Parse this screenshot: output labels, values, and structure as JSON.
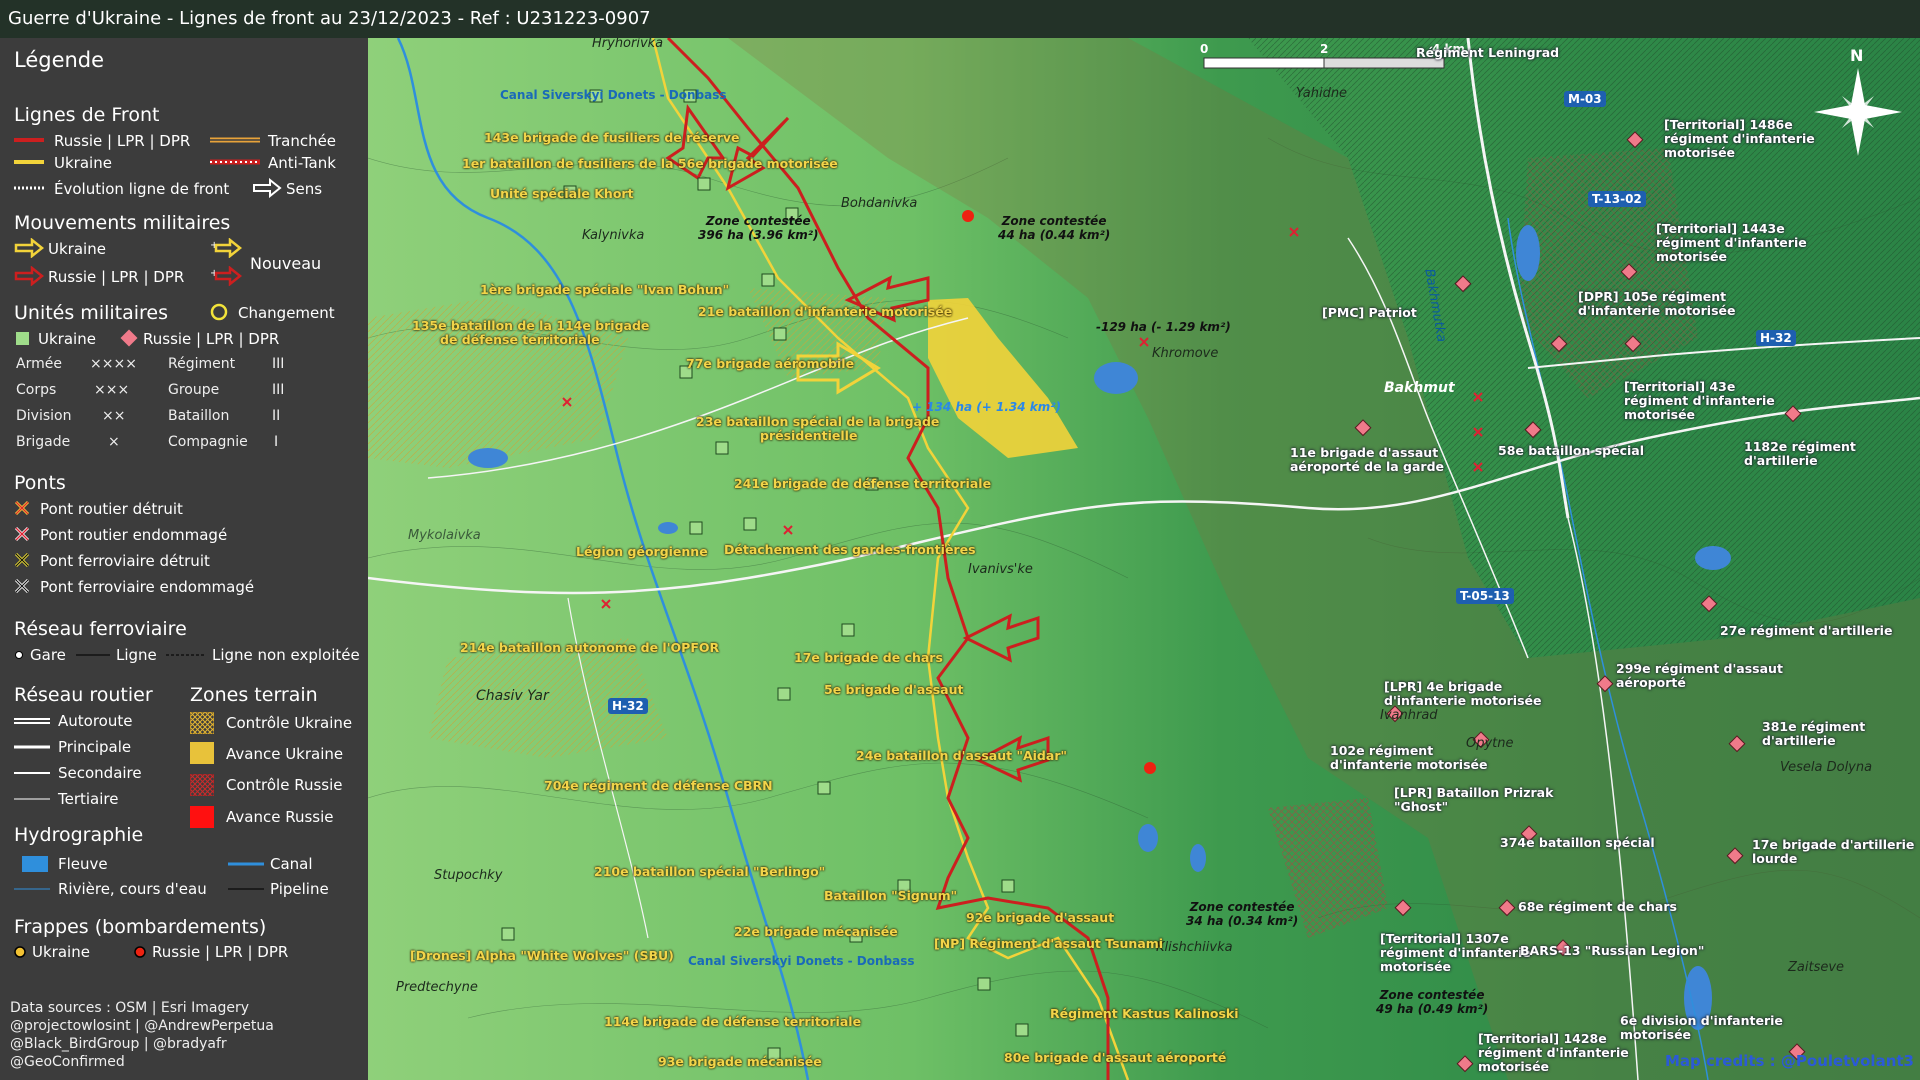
{
  "title": "Guerre d'Ukraine - Lignes de front au 23/12/2023 - Ref : U231223-0907",
  "legend": {
    "heading": "Légende",
    "front_lines": {
      "title": "Lignes de Front",
      "russia": "Russie | LPR | DPR",
      "ukraine": "Ukraine",
      "trench": "Tranchée",
      "antitank": "Anti-Tank",
      "evolution": "Évolution ligne de front",
      "direction": "Sens"
    },
    "movements": {
      "title": "Mouvements militaires",
      "ukraine": "Ukraine",
      "russia": "Russie | LPR | DPR",
      "new": "Nouveau"
    },
    "units": {
      "title": "Unités militaires",
      "change": "Changement",
      "ukraine": "Ukraine",
      "russia": "Russie | LPR | DPR",
      "rows": [
        {
          "a": "Armée",
          "as": "××××",
          "b": "Régiment",
          "bs": "III"
        },
        {
          "a": "Corps",
          "as": "×××",
          "b": "Groupe",
          "bs": "III"
        },
        {
          "a": "Division",
          "as": "××",
          "b": "Bataillon",
          "bs": "II"
        },
        {
          "a": "Brigade",
          "as": "×",
          "b": "Compagnie",
          "bs": "I"
        }
      ]
    },
    "bridges": {
      "title": "Ponts",
      "items": [
        "Pont routier détruit",
        "Pont routier endommagé",
        "Pont ferroviaire détruit",
        "Pont ferroviaire endommagé"
      ]
    },
    "rail": {
      "title": "Réseau ferroviaire",
      "station": "Gare",
      "line": "Ligne",
      "unused": "Ligne non exploitée"
    },
    "roads": {
      "title": "Réseau routier",
      "items": [
        "Autoroute",
        "Principale",
        "Secondaire",
        "Tertiaire"
      ]
    },
    "terrain": {
      "title": "Zones terrain",
      "items": [
        "Contrôle Ukraine",
        "Avance Ukraine",
        "Contrôle Russie",
        "Avance Russie"
      ]
    },
    "hydro": {
      "title": "Hydrographie",
      "river": "Fleuve",
      "canal": "Canal",
      "stream": "Rivière, cours d'eau",
      "pipeline": "Pipeline"
    },
    "strikes": {
      "title": "Frappes (bombardements)",
      "ukraine": "Ukraine",
      "russia": "Russie | LPR | DPR"
    },
    "sources": [
      "Data sources : OSM | Esri Imagery",
      "@projectowlosint | @AndrewPerpetua",
      "@Black_BirdGroup | @bradyafr",
      "@GeoConfirmed"
    ]
  },
  "colors": {
    "russia": "#cc1f1f",
    "ukraine": "#f2d33a",
    "trench": "#e8a33a",
    "water": "#3a78c8",
    "road_badge": "#1e5fb0",
    "panel": "#3c3c3c"
  },
  "map": {
    "scale": [
      "0",
      "2",
      "4 km"
    ],
    "north": "N",
    "towns": [
      "Bohdanivka",
      "Kalynivka",
      "Chasiv Yar",
      "Ivanivs'ke",
      "Khromove",
      "Bakhmut",
      "Yahidne",
      "Opytne",
      "Ivanhrad",
      "Vesela Dolyna",
      "Zaitseve",
      "Klishchiivka",
      "Predtechyne",
      "Stupochky",
      "Hryhorivka",
      "Mykolaivka",
      "Bakhmutka"
    ],
    "canal": "Canal Siverskyi Donets - Donbass",
    "roads": [
      "M-03",
      "T-13-02",
      "H-32",
      "T-05-13",
      "H-32"
    ],
    "zones": [
      {
        "t1": "Zone contestée",
        "t2": "396 ha (3.96 km²)"
      },
      {
        "t1": "Zone contestée",
        "t2": "44 ha (0.44 km²)"
      },
      {
        "t1": "-129 ha (- 1.29 km²)",
        "t2": ""
      },
      {
        "t1": "+ 134 ha (+ 1.34 km²)",
        "t2": ""
      },
      {
        "t1": "Zone contestée",
        "t2": "34 ha (0.34 km²)"
      },
      {
        "t1": "Zone contestée",
        "t2": "49 ha (0.49 km²)"
      }
    ],
    "ua_units": [
      "143e brigade de fusiliers de réserve",
      "1er bataillon de fusiliers de la 56e brigade motorisée",
      "Unité spéciale Khort",
      "1ère brigade spéciale \"Ivan Bohun\"",
      "21e bataillon d'infanterie motorisée",
      "135e bataillon de la 114e brigade",
      "de défense territoriale",
      "77e brigade aéromobile",
      "23e bataillon spécial de la brigade",
      "présidentielle",
      "241e brigade de défense territoriale",
      "Légion géorgienne",
      "Détachement des gardes-frontières",
      "214e bataillon autonome de l'OPFOR",
      "17e brigade de chars",
      "5e brigade d'assaut",
      "24e bataillon d'assaut \"Aidar\"",
      "704e régiment de défense CBRN",
      "210e bataillon spécial \"Berlingo\"",
      "Bataillon \"Signum\"",
      "92e brigade d'assaut",
      "22e brigade mécanisée",
      "[NP] Régiment d'assaut Tsunami",
      "[Drones] Alpha \"White Wolves\" (SBU)",
      "114e brigade de défense territoriale",
      "Régiment Kastus Kalinoski",
      "93e brigade mécanisée",
      "80e brigade d'assaut aéroporté"
    ],
    "ru_units": [
      "Régiment Leningrad",
      "[Territorial] 1486e",
      "régiment d'infanterie",
      "motorisée",
      "[Territorial] 1443e",
      "régiment d'infanterie",
      "motorisée",
      "[DPR] 105e régiment",
      "d'infanterie motorisée",
      "[PMC] Patriot",
      "[Territorial] 43e",
      "régiment d'infanterie",
      "motorisée",
      "11e brigade d'assaut",
      "aéroporté de la garde",
      "58e bataillon spécial",
      "1182e régiment",
      "d'artillerie",
      "27e régiment d'artillerie",
      "299e régiment d'assaut",
      "aéroporté",
      "[LPR] 4e brigade",
      "d'infanterie motorisée",
      "381e régiment",
      "d'artillerie",
      "102e régiment",
      "d'infanterie motorisée",
      "[LPR] Bataillon Prizrak",
      "\"Ghost\"",
      "374e bataillon spécial",
      "17e brigade d'artillerie",
      "lourde",
      "68e régiment de chars",
      "[Territorial] 1307e",
      "régiment d'infanterie",
      "motorisée",
      "BARS-13 \"Russian Legion\"",
      "6e division d'infanterie",
      "motorisée",
      "[Territorial] 1428e",
      "régiment d'infanterie",
      "motorisée"
    ],
    "credits": "Map credits : @Pouletvolant3"
  }
}
